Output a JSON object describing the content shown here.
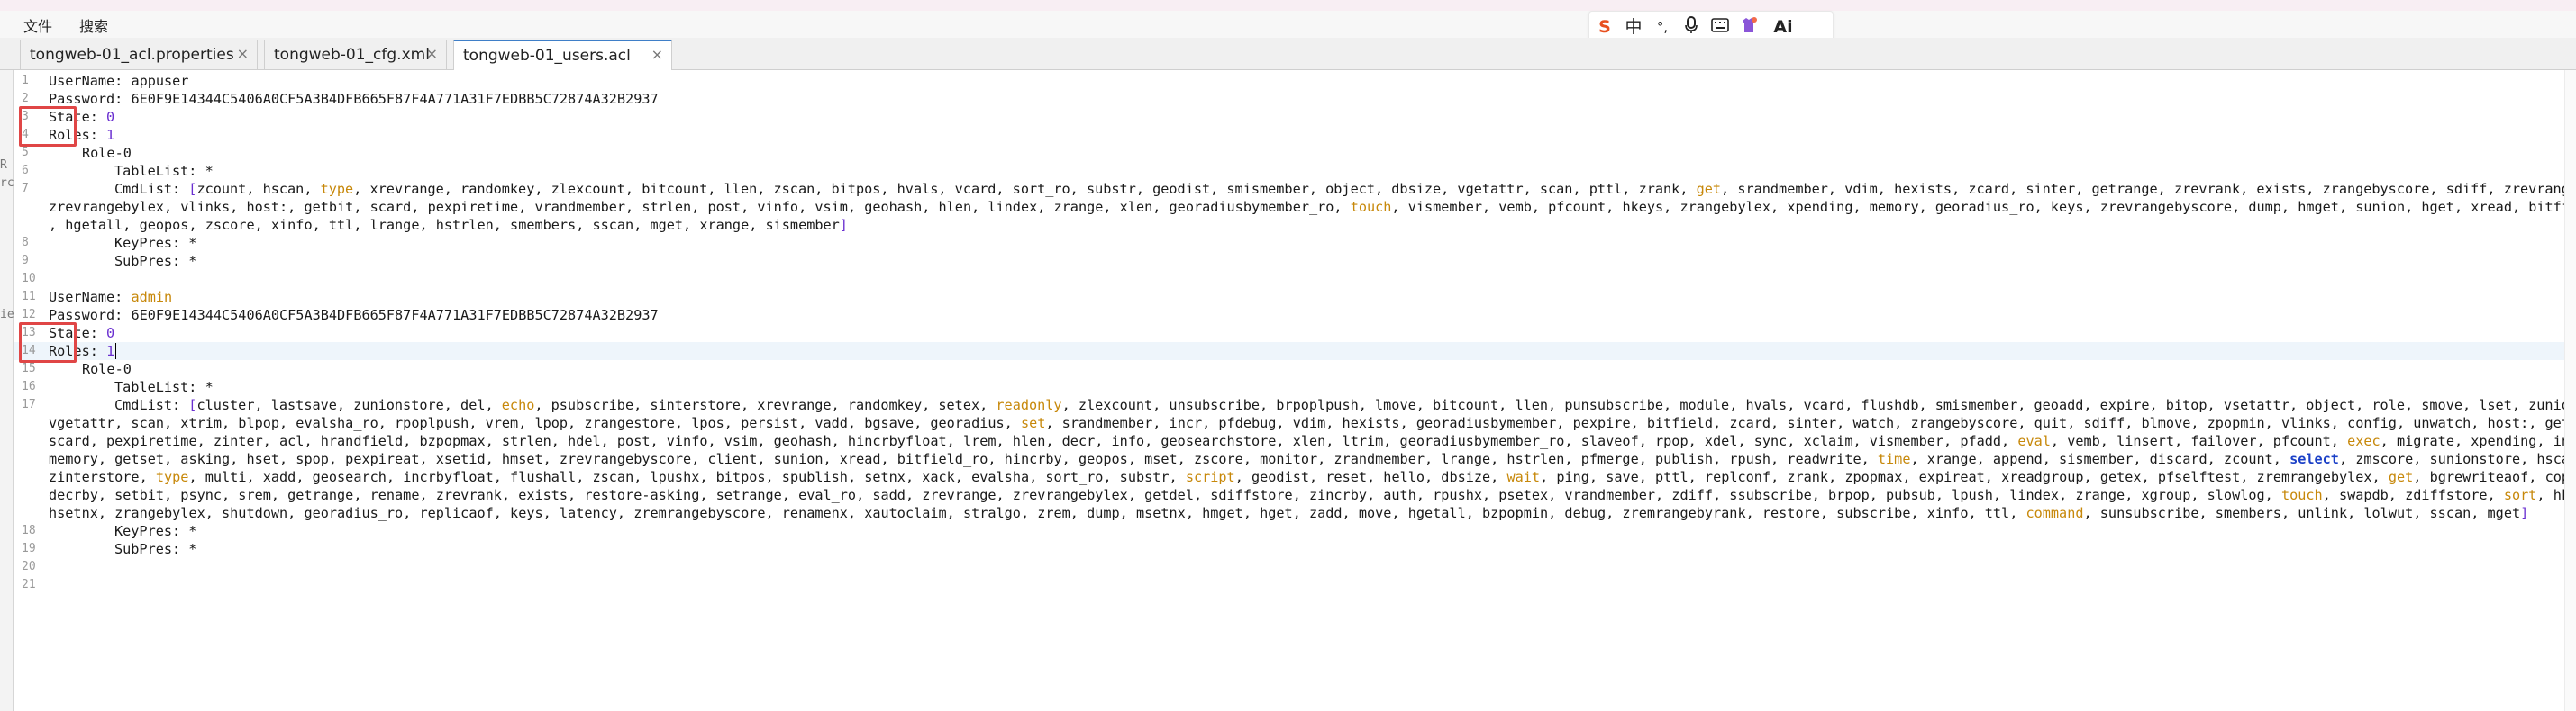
{
  "menu": {
    "file": "文件",
    "search": "搜索"
  },
  "ime": {
    "logo": "S",
    "mode": "中",
    "punct": "°,",
    "voice": "mic-icon",
    "keyboard": "keyboard-icon",
    "skin": "skin-icon",
    "ai": "Ai"
  },
  "tabs": [
    {
      "label": "tongweb-01_acl.properties",
      "close": "×"
    },
    {
      "label": "tongweb-01_cfg.xml",
      "close": "×"
    },
    {
      "label": "tongweb-01_users.acl",
      "close": "×"
    }
  ],
  "active_tab": 2,
  "left_panel": {
    "fragments": [
      "R",
      "rc",
      "ie"
    ]
  },
  "colors": {
    "keyword": "#c7880a",
    "value": "#6a2fd0",
    "select": "#1b40c7",
    "highlight_box": "#e04646",
    "active_tab_border": "#3f7fc8"
  },
  "editor": {
    "line_numbers": [
      "1",
      "2",
      "3",
      "4",
      "5",
      "6",
      "7",
      "8",
      "9",
      "10",
      "11",
      "12",
      "13",
      "14",
      "15",
      "16",
      "17",
      "18",
      "19",
      "20",
      "21"
    ],
    "user1": {
      "username_key": "UserName: ",
      "username": "appuser",
      "password_key": "Password: ",
      "password": "6E0F9E14344C5406A0CF5A3B4DFB665F87F4A771A31F7EDBB5C72874A32B2937",
      "state_key": "State: ",
      "state": "0",
      "roles_key": "Roles: ",
      "roles": "1",
      "role_header": "Role-0",
      "tablelist": "TableList: *",
      "cmdlist_key": "CmdList: ",
      "cmd_l1": "[zcount, hscan, type, xrevrange, randomkey, zlexcount, bitcount, llen, zscan, bitpos, hvals, vcard, sort_ro, substr, geodist, smismember, object, dbsize, vgetattr, scan, pttl, zrank, get, srandmember, vdim, hexists, zcard, sinter, getrange, zrevrank, exists, zrangebyscore, sdiff, zrevrange,",
      "cmd_l2": "zrevrangebylex, vlinks, host:, getbit, scard, pexpiretime, vrandmember, strlen, post, vinfo, vsim, geohash, hlen, lindex, zrange, xlen, georadiusbymember_ro, touch, vismember, vemb, pfcount, hkeys, zrangebylex, xpending, memory, georadius_ro, keys, zrevrangebyscore, dump, hmget, sunion, hget, xread, bitfield_ro",
      "cmd_l3": ", hgetall, geopos, zscore, xinfo, ttl, lrange, hstrlen, smembers, sscan, mget, xrange, sismember]",
      "keypres": "KeyPres: *",
      "subpres": "SubPres: *"
    },
    "user2": {
      "username_key": "UserName: ",
      "username": "admin",
      "password_key": "Password: ",
      "password": "6E0F9E14344C5406A0CF5A3B4DFB665F87F4A771A31F7EDBB5C72874A32B2937",
      "state_key": "State: ",
      "state": "0",
      "roles_key": "Roles: ",
      "roles": "1",
      "role_header": "Role-0",
      "tablelist": "TableList: *",
      "cmdlist_key": "CmdList: ",
      "cmd_lines": [
        "[cluster, lastsave, zunionstore, del, echo, psubscribe, sinterstore, xrevrange, randomkey, setex, readonly, zlexcount, unsubscribe, brpoplpush, lmove, bitcount, llen, punsubscribe, module, hvals, vcard, flushdb, smismember, geoadd, expire, bitop, vsetattr, object, role, smove, lset, zunion,",
        "vgetattr, scan, xtrim, blpop, evalsha_ro, rpoplpush, vrem, lpop, zrangestore, lpos, persist, vadd, bgsave, georadius, set, srandmember, incr, pfdebug, vdim, hexists, georadiusbymember, pexpire, bitfield, zcard, sinter, watch, zrangebyscore, quit, sdiff, blmove, zpopmin, vlinks, config, unwatch, host:, getbit,",
        "scard, pexpiretime, zinter, acl, hrandfield, bzpopmax, strlen, hdel, post, vinfo, vsim, geohash, hincrbyfloat, lrem, hlen, decr, info, geosearchstore, xlen, ltrim, georadiusbymember_ro, slaveof, rpop, xdel, sync, xclaim, vismember, pfadd, eval, vemb, linsert, failover, pfcount, exec, migrate, xpending, incrby,",
        "memory, getset, asking, hset, spop, pexpireat, xsetid, hmset, zrevrangebyscore, client, sunion, xread, bitfield_ro, hincrby, geopos, mset, zscore, monitor, zrandmember, lrange, hstrlen, pfmerge, publish, rpush, readwrite, time, xrange, append, sismember, discard, zcount, select, zmscore, sunionstore, hscan,",
        "zinterstore, type, multi, xadd, geosearch, incrbyfloat, flushall, zscan, lpushx, bitpos, spublish, setnx, xack, evalsha, sort_ro, substr, script, geodist, reset, hello, dbsize, wait, ping, save, pttl, replconf, zrank, zpopmax, expireat, xreadgroup, getex, pfselftest, zremrangebylex, get, bgrewriteaof, copy,",
        "decrby, setbit, psync, srem, getrange, rename, zrevrank, exists, restore-asking, setrange, eval_ro, sadd, zrevrange, zrevrangebylex, getdel, sdiffstore, zincrby, auth, rpushx, psetex, vrandmember, zdiff, ssubscribe, brpop, pubsub, lpush, lindex, zrange, xgroup, slowlog, touch, swapdb, zdiffstore, sort, hkeys,",
        "hsetnx, zrangebylex, shutdown, georadius_ro, replicaof, keys, latency, zremrangebyscore, renamenx, xautoclaim, stralgo, zrem, dump, msetnx, hmget, hget, zadd, move, hgetall, bzpopmin, debug, zremrangebyrank, restore, subscribe, xinfo, ttl, command, sunsubscribe, smembers, unlink, lolwut, sscan, mget]"
      ],
      "keypres": "KeyPres: *",
      "subpres": "SubPres: *"
    }
  }
}
